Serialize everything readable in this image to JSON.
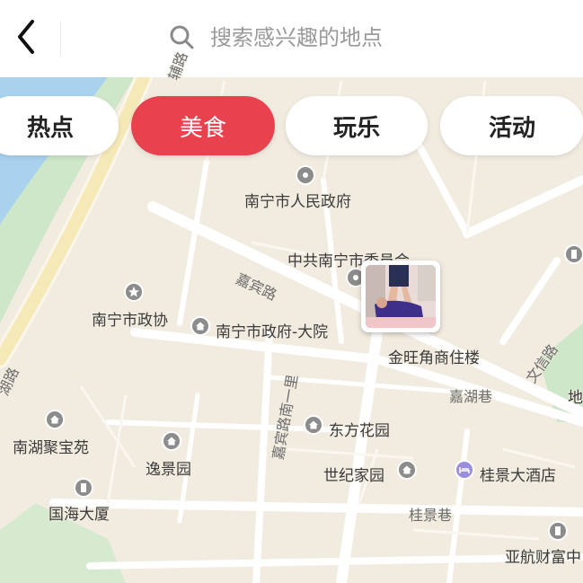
{
  "search": {
    "placeholder": "搜索感兴趣的地点"
  },
  "tabs": [
    {
      "label": "热点"
    },
    {
      "label": "美食"
    },
    {
      "label": "玩乐"
    },
    {
      "label": "活动"
    }
  ],
  "places": {
    "gov": "南宁市人民政府",
    "party": "中共南宁市委员会",
    "zhengxie": "南宁市政协",
    "gov_yard": "南宁市政府-大院",
    "jinwang": "金旺角商住楼",
    "dongfang": "东方花园",
    "nanhu_jubao": "南湖聚宝苑",
    "yijing": "逸景园",
    "shiji": "世纪家园",
    "guijing_hotel": "桂景大酒店",
    "guohai": "国海大厦",
    "yahang": "亚航财富中",
    "edge_di": "地"
  },
  "streets": {
    "jiabin": "嘉宾路",
    "jiabin_1": "嘉宾路南一里",
    "jiahu": "嘉湖巷",
    "wenxin": "文信路",
    "guijing": "桂景巷",
    "hu": "湖路",
    "top": "辅路"
  },
  "colors": {
    "land": "#f2ece0",
    "road": "#ffffff",
    "water": "#a9d2ee",
    "green": "#cde7c8",
    "accent": "#e8424f",
    "hotel_icon": "#9b8ee0"
  }
}
